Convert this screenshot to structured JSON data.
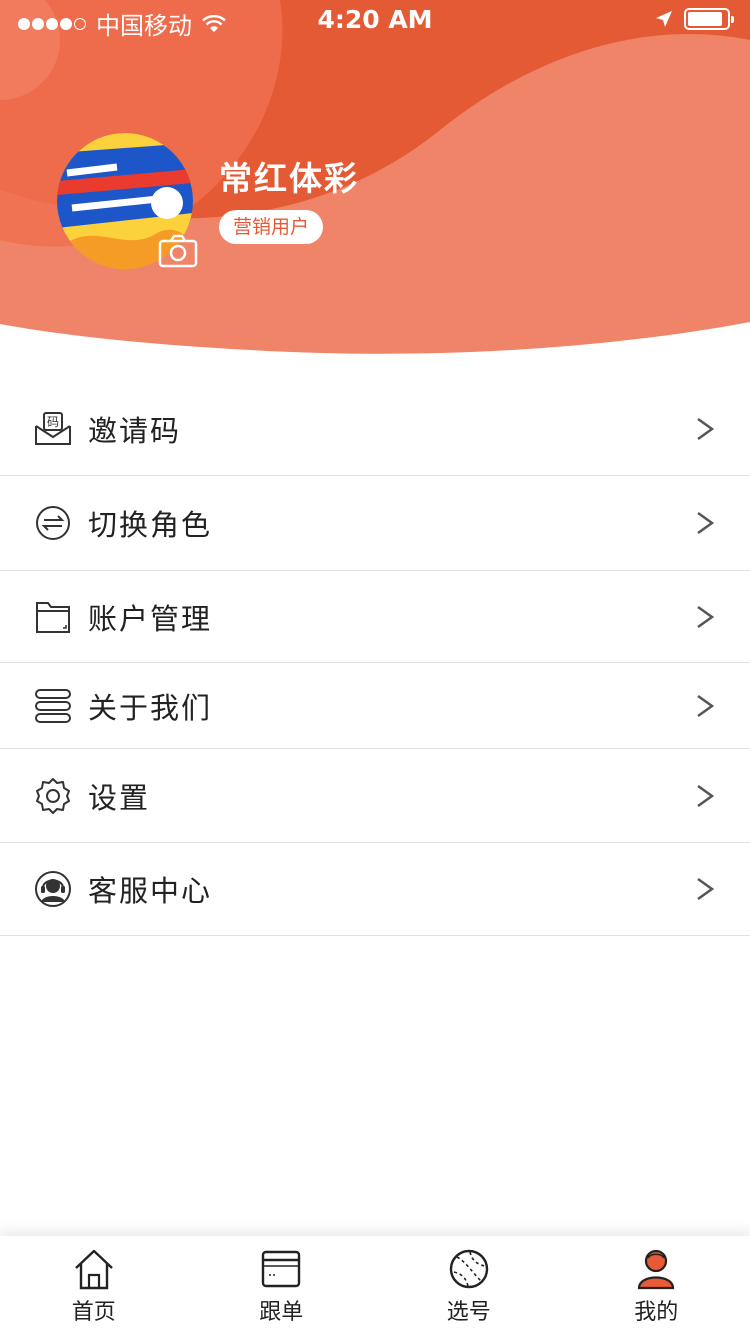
{
  "status_bar": {
    "carrier": "中国移动",
    "time": "4:20 AM"
  },
  "profile": {
    "username": "常红体彩",
    "role": "营销用户",
    "avatar_icon": "avatar-image",
    "camera_icon": "camera-icon"
  },
  "menu": {
    "items": [
      {
        "label": "邀请码",
        "icon": "invite-code-icon",
        "icon_text": "码"
      },
      {
        "label": "切换角色",
        "icon": "switch-icon"
      },
      {
        "label": "账户管理",
        "icon": "folder-icon"
      },
      {
        "label": "关于我们",
        "icon": "layers-icon"
      },
      {
        "label": "设置",
        "icon": "gear-icon"
      },
      {
        "label": "客服中心",
        "icon": "headset-icon"
      }
    ]
  },
  "tabs": [
    {
      "label": "首页",
      "icon": "home-icon"
    },
    {
      "label": "跟单",
      "icon": "order-card-icon"
    },
    {
      "label": "选号",
      "icon": "ball-icon"
    },
    {
      "label": "我的",
      "icon": "user-icon",
      "active": true
    }
  ],
  "colors": {
    "accent": "#e85a36",
    "header_light": "#f07b5e"
  }
}
